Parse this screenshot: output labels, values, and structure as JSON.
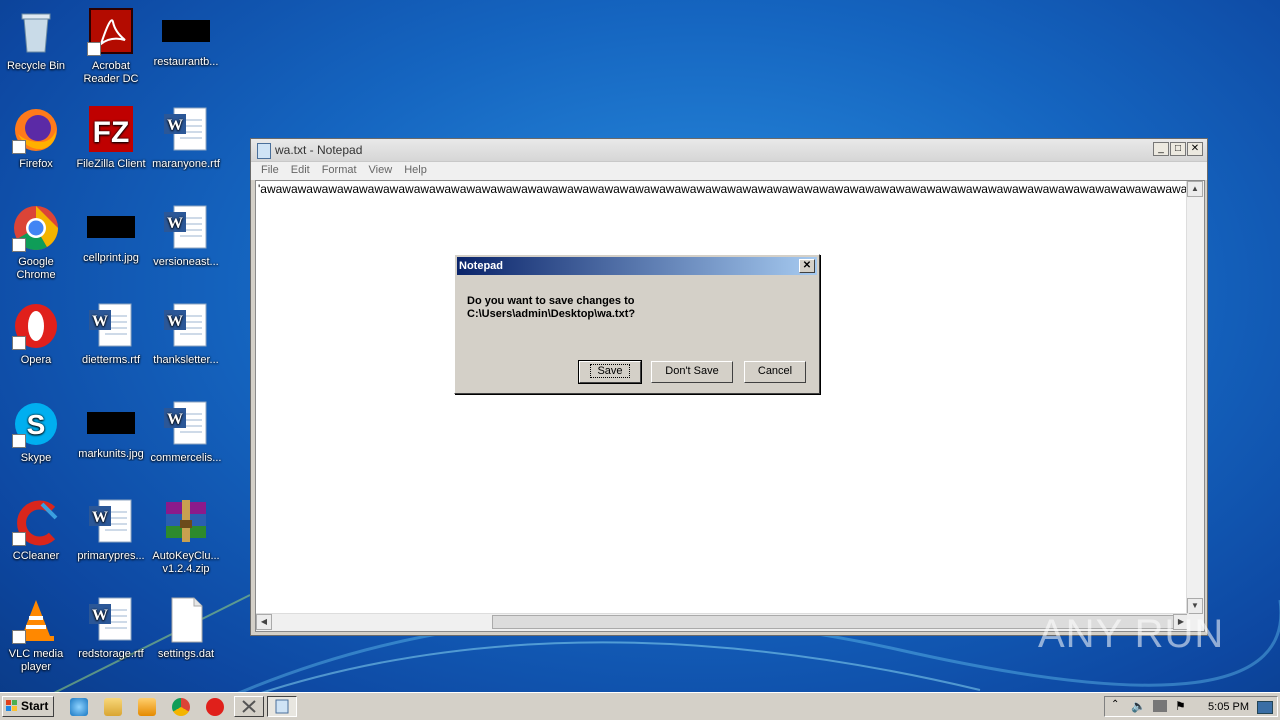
{
  "desktop": {
    "icons": [
      {
        "label": "Recycle Bin",
        "label2": ""
      },
      {
        "label": "Acrobat",
        "label2": "Reader DC"
      },
      {
        "label": "restaurantb...",
        "label2": ""
      },
      {
        "label": "Firefox",
        "label2": ""
      },
      {
        "label": "FileZilla Client",
        "label2": ""
      },
      {
        "label": "maranyone.rtf",
        "label2": ""
      },
      {
        "label": "Google",
        "label2": "Chrome"
      },
      {
        "label": "cellprint.jpg",
        "label2": ""
      },
      {
        "label": "versioneast...",
        "label2": ""
      },
      {
        "label": "Opera",
        "label2": ""
      },
      {
        "label": "dietterms.rtf",
        "label2": ""
      },
      {
        "label": "thanksletter...",
        "label2": ""
      },
      {
        "label": "Skype",
        "label2": ""
      },
      {
        "label": "markunits.jpg",
        "label2": ""
      },
      {
        "label": "commercelis...",
        "label2": ""
      },
      {
        "label": "CCleaner",
        "label2": ""
      },
      {
        "label": "primarypres...",
        "label2": ""
      },
      {
        "label": "AutoKeyClu...",
        "label2": "v1.2.4.zip"
      },
      {
        "label": "VLC media",
        "label2": "player"
      },
      {
        "label": "redstorage.rtf",
        "label2": ""
      },
      {
        "label": "settings.dat",
        "label2": ""
      }
    ]
  },
  "notepad": {
    "title": "wa.txt - Notepad",
    "menu": [
      "File",
      "Edit",
      "Format",
      "View",
      "Help"
    ],
    "content": "'awawawawawawawawawawawawawawawawawawawawawawawawawawawawawawawawawawawawawawawawawawawawawawawawawawawawawawawawawawawawawawawawawawawawawawawawawawawawawawawawawawawawawawawawawawawawawaw"
  },
  "dialog": {
    "title": "Notepad",
    "message_line1": "Do you want to save changes to",
    "message_line2": "C:\\Users\\admin\\Desktop\\wa.txt?",
    "save_label": "Save",
    "dont_save_label": "Don't Save",
    "cancel_label": "Cancel"
  },
  "watermark": "ANY RUN",
  "taskbar": {
    "start_label": "Start",
    "clock": "5:05 PM"
  },
  "colors": {
    "dialog_title_start": "#0a246a",
    "dialog_title_end": "#a6caf0",
    "desktop_bg": "#1565c0"
  }
}
